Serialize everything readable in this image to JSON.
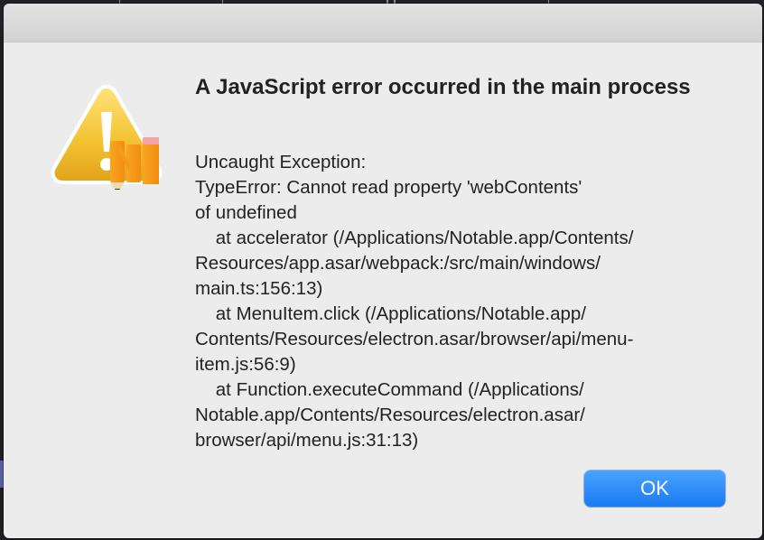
{
  "dialog": {
    "title": "A JavaScript error occurred in the main process",
    "message_lines": [
      "Uncaught Exception:",
      "TypeError: Cannot read property 'webContents'",
      "of undefined",
      "    at accelerator (/Applications/Notable.app/Contents/",
      "Resources/app.asar/webpack:/src/main/windows/",
      "main.ts:156:13)",
      "    at MenuItem.click (/Applications/Notable.app/",
      "Contents/Resources/electron.asar/browser/api/menu-",
      "item.js:56:9)",
      "    at Function.executeCommand (/Applications/",
      "Notable.app/Contents/Resources/electron.asar/",
      "browser/api/menu.js:31:13)"
    ],
    "ok_label": "OK",
    "icon": "warning-with-notable-app-icon"
  },
  "colors": {
    "button_accent": "#1a7bf2",
    "warning_yellow": "#f2c13a"
  }
}
